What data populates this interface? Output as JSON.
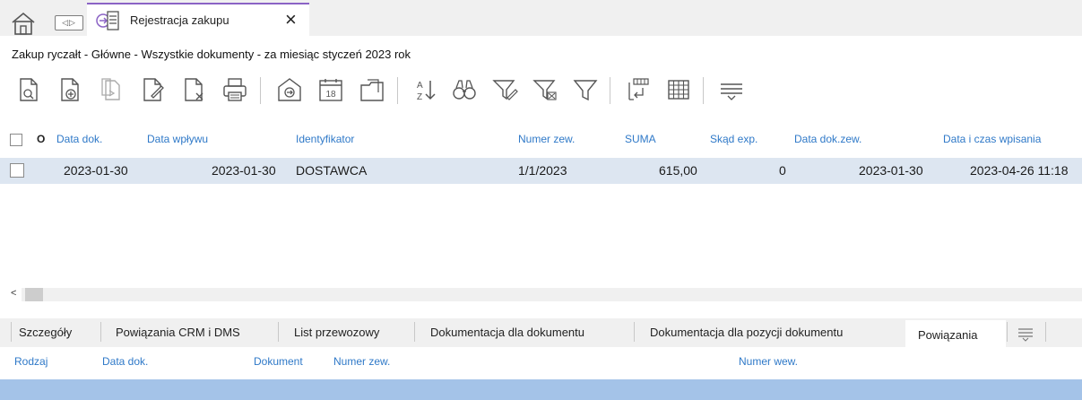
{
  "tabs": {
    "active_label": "Rejestracja zakupu",
    "close_glyph": "×",
    "nav_glyph": "◁▷"
  },
  "breadcrumb": "Zakup ryczałt - Główne - Wszystkie dokumenty - za miesiąc styczeń 2023 rok",
  "toolbar": {
    "calendar_day": "18",
    "sort_glyph_top": "A",
    "sort_glyph_bottom": "Z"
  },
  "grid": {
    "columns": {
      "marker": "O",
      "data_dok": "Data dok.",
      "data_wplywu": "Data wpływu",
      "identyfikator": "Identyfikator",
      "numer_zew": "Numer zew.",
      "suma": "SUMA",
      "skad_exp": "Skąd exp.",
      "data_dok_zew": "Data dok.zew.",
      "data_czas_wpisania": "Data i czas wpisania"
    },
    "rows": [
      {
        "data_dok": "2023-01-30",
        "data_wplywu": "2023-01-30",
        "identyfikator": "DOSTAWCA",
        "numer_zew": "1/1/2023",
        "suma": "615,00",
        "skad_exp": "0",
        "data_dok_zew": "2023-01-30",
        "data_czas_wpisania": "2023-04-26 11:18"
      }
    ]
  },
  "scroll_left_glyph": "<",
  "bottom_tabs": [
    "Szczegóły",
    "Powiązania CRM i DMS",
    "List przewozowy",
    "Dokumentacja dla dokumentu",
    "Dokumentacja dla pozycji dokumentu",
    "Powiązania"
  ],
  "detail_columns": {
    "rodzaj": "Rodzaj",
    "data_dok": "Data dok.",
    "dokument": "Dokument",
    "numer_zew": "Numer zew.",
    "numer_wew": "Numer wew."
  },
  "colors": {
    "accent_tab": "#8b63c5",
    "header_text": "#2f79c8",
    "selected_row": "#dde6f1",
    "detail_bar": "#a4c3e8"
  }
}
